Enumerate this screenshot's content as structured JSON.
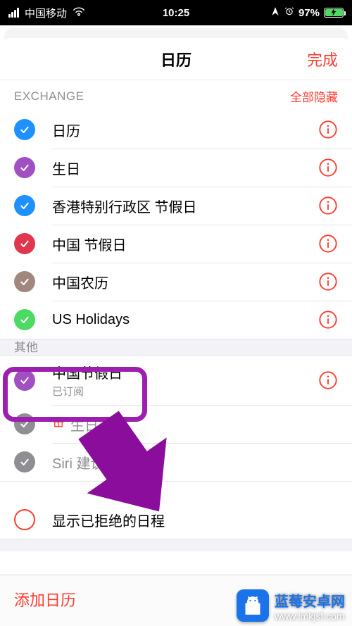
{
  "statusbar": {
    "carrier": "中国移动",
    "time": "10:25",
    "battery_percent": "97%"
  },
  "sheet": {
    "title": "日历",
    "done": "完成"
  },
  "sections": {
    "exchange": {
      "title": "EXCHANGE",
      "hide_all": "全部隐藏",
      "items": [
        {
          "label": "日历",
          "color": "c-blue"
        },
        {
          "label": "生日",
          "color": "c-purple"
        },
        {
          "label": "香港特别行政区 节假日",
          "color": "c-blue"
        },
        {
          "label": "中国 节假日",
          "color": "c-red"
        },
        {
          "label": "中国农历",
          "color": "c-brown"
        },
        {
          "label": "US Holidays",
          "color": "c-green"
        }
      ]
    },
    "other": {
      "title": "其他",
      "items": [
        {
          "label": "中国节假日",
          "sub": "已订阅",
          "color": "c-purple",
          "info": true
        },
        {
          "label": "生日",
          "color": "c-gray",
          "gift": true
        },
        {
          "label": "Siri 建议",
          "color": "c-gray"
        }
      ],
      "rejected_label": "显示已拒绝的日程"
    }
  },
  "footer": {
    "add_calendar": "添加日历"
  },
  "watermark": {
    "line1": "蓝莓安卓网",
    "line2": "www.lmkjsf.com"
  }
}
